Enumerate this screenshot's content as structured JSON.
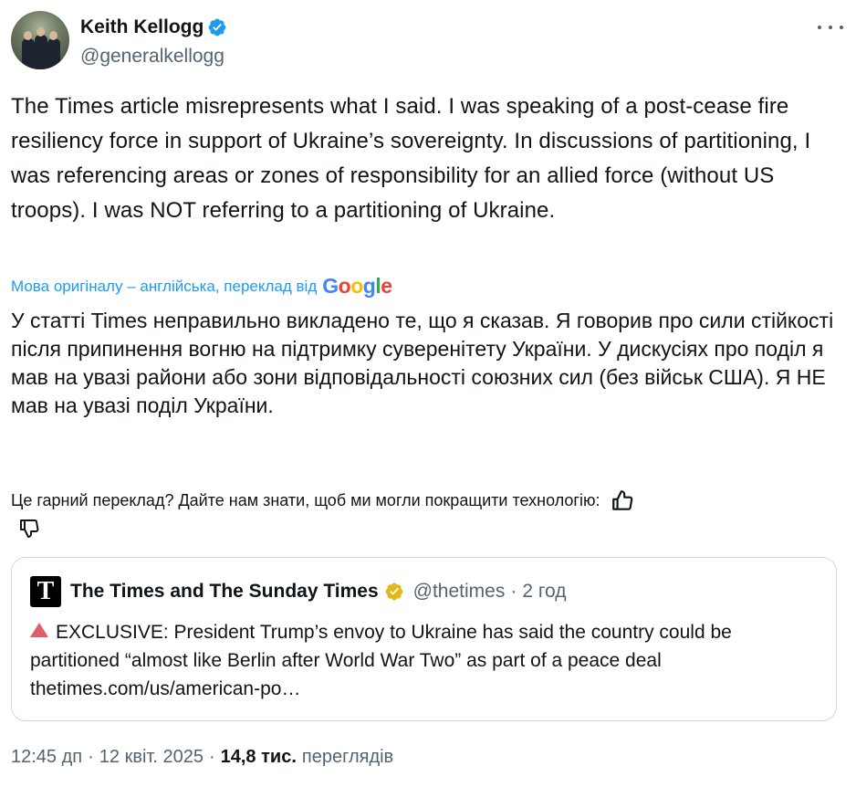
{
  "author": {
    "name": "Keith Kellogg",
    "handle": "@generalkellogg",
    "verified_color": "#1d9bf0"
  },
  "tweet": {
    "text": "The Times article misrepresents what I said. I was speaking of a post-cease fire resiliency force in support of Ukraine’s sovereignty. In discussions of partitioning, I was referencing areas or zones of responsibility for an allied force (without US troops). I was NOT referring to a partitioning of Ukraine."
  },
  "translation": {
    "label": "Мова оригіналу – англійська, переклад від",
    "provider_letters": [
      "G",
      "o",
      "o",
      "g",
      "l",
      "e"
    ],
    "text": "У статті Times неправильно викладено те, що я сказав. Я говорив про сили стійкості після припинення вогню на підтримку суверенітету України. У дискусіях про поділ я мав на увазі райони або зони відповідальності союзних сил (без військ США). Я НЕ мав на увазі поділ України.",
    "feedback_prompt": "Це гарний переклад? Дайте нам знати, щоб ми могли покращити технологію:"
  },
  "quoted_tweet": {
    "logo_letter": "T",
    "name": "The Times and The Sunday Times",
    "handle": "@thetimes",
    "separator": "·",
    "time": "2 год",
    "text": "EXCLUSIVE: President Trump’s envoy to Ukraine has said the country could be partitioned “almost like Berlin after World War Two” as part of a peace deal",
    "link": "thetimes.com/us/american-po…",
    "verified_color": "#e2b719"
  },
  "meta": {
    "time": "12:45 дп",
    "sep1": "·",
    "date": "12 квіт. 2025",
    "sep2": "·",
    "views_count": "14,8 тис.",
    "views_label": "переглядів"
  },
  "icons": {
    "more": "more-icon",
    "thumbs_up": "thumbs-up-icon",
    "thumbs_down": "thumbs-down-icon",
    "verified": "verified-badge-icon"
  }
}
